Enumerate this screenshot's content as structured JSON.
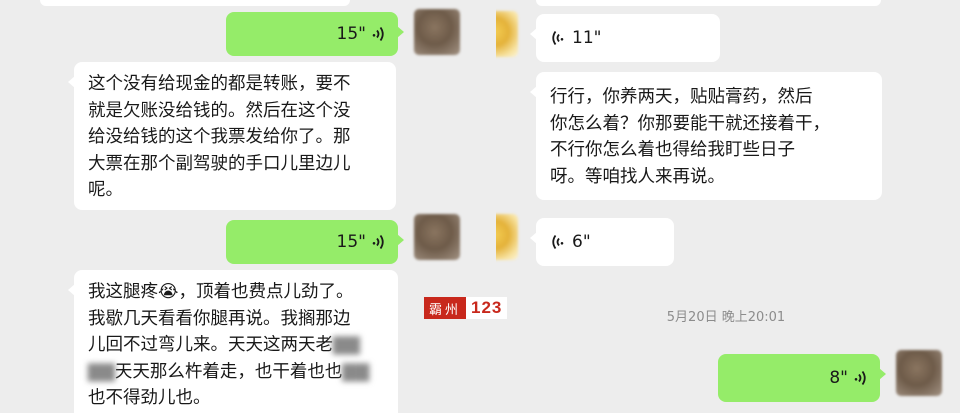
{
  "left_chat": {
    "messages": [
      {
        "type": "voice",
        "direction": "sent",
        "duration": "15\""
      },
      {
        "type": "text",
        "direction": "received",
        "lines": [
          "这个没有给现金的都是转账，要不",
          "就是欠账没给钱的。然后在这个没",
          "给没给钱的这个我票发给你了。那",
          "大票在那个副驾驶的手口儿里边儿",
          "呢。"
        ]
      },
      {
        "type": "voice",
        "direction": "sent",
        "duration": "15\""
      },
      {
        "type": "text",
        "direction": "received",
        "line1_prefix": "我这腿疼",
        "emoji": "😭",
        "line1_suffix": "，顶着也费点儿劲了。",
        "lines": [
          "我歇几天看看你腿再说。我搁那边",
          "儿回不过弯儿来。天天这两天老"
        ],
        "blur1": "▇▇",
        "line5_blur": "▇▇",
        "line5": "天天那么杵着走，也干着也也",
        "blur2": "▇▇",
        "line6": "也不得劲儿也。"
      }
    ]
  },
  "right_chat": {
    "messages": [
      {
        "type": "voice",
        "direction": "received",
        "duration": "11\""
      },
      {
        "type": "text",
        "direction": "received",
        "lines": [
          "行行，你养两天，贴贴膏药，然后",
          "你怎么着？你那要能干就还接着干，",
          "不行你怎么着也得给我盯些日子",
          "呀。等咱找人来再说。"
        ]
      },
      {
        "type": "voice",
        "direction": "received",
        "duration": "6\""
      },
      {
        "type": "voice",
        "direction": "sent",
        "duration": "8\""
      }
    ],
    "timestamp": "5月20日 晚上20:01"
  },
  "watermark": {
    "left_text": "霸州",
    "right_text": "123"
  },
  "colors": {
    "sent_bubble": "#95ec69",
    "received_bubble": "#ffffff",
    "background": "#ededed",
    "watermark_red": "#c8281c"
  },
  "icons": {
    "voice": "voice-wave-icon"
  }
}
